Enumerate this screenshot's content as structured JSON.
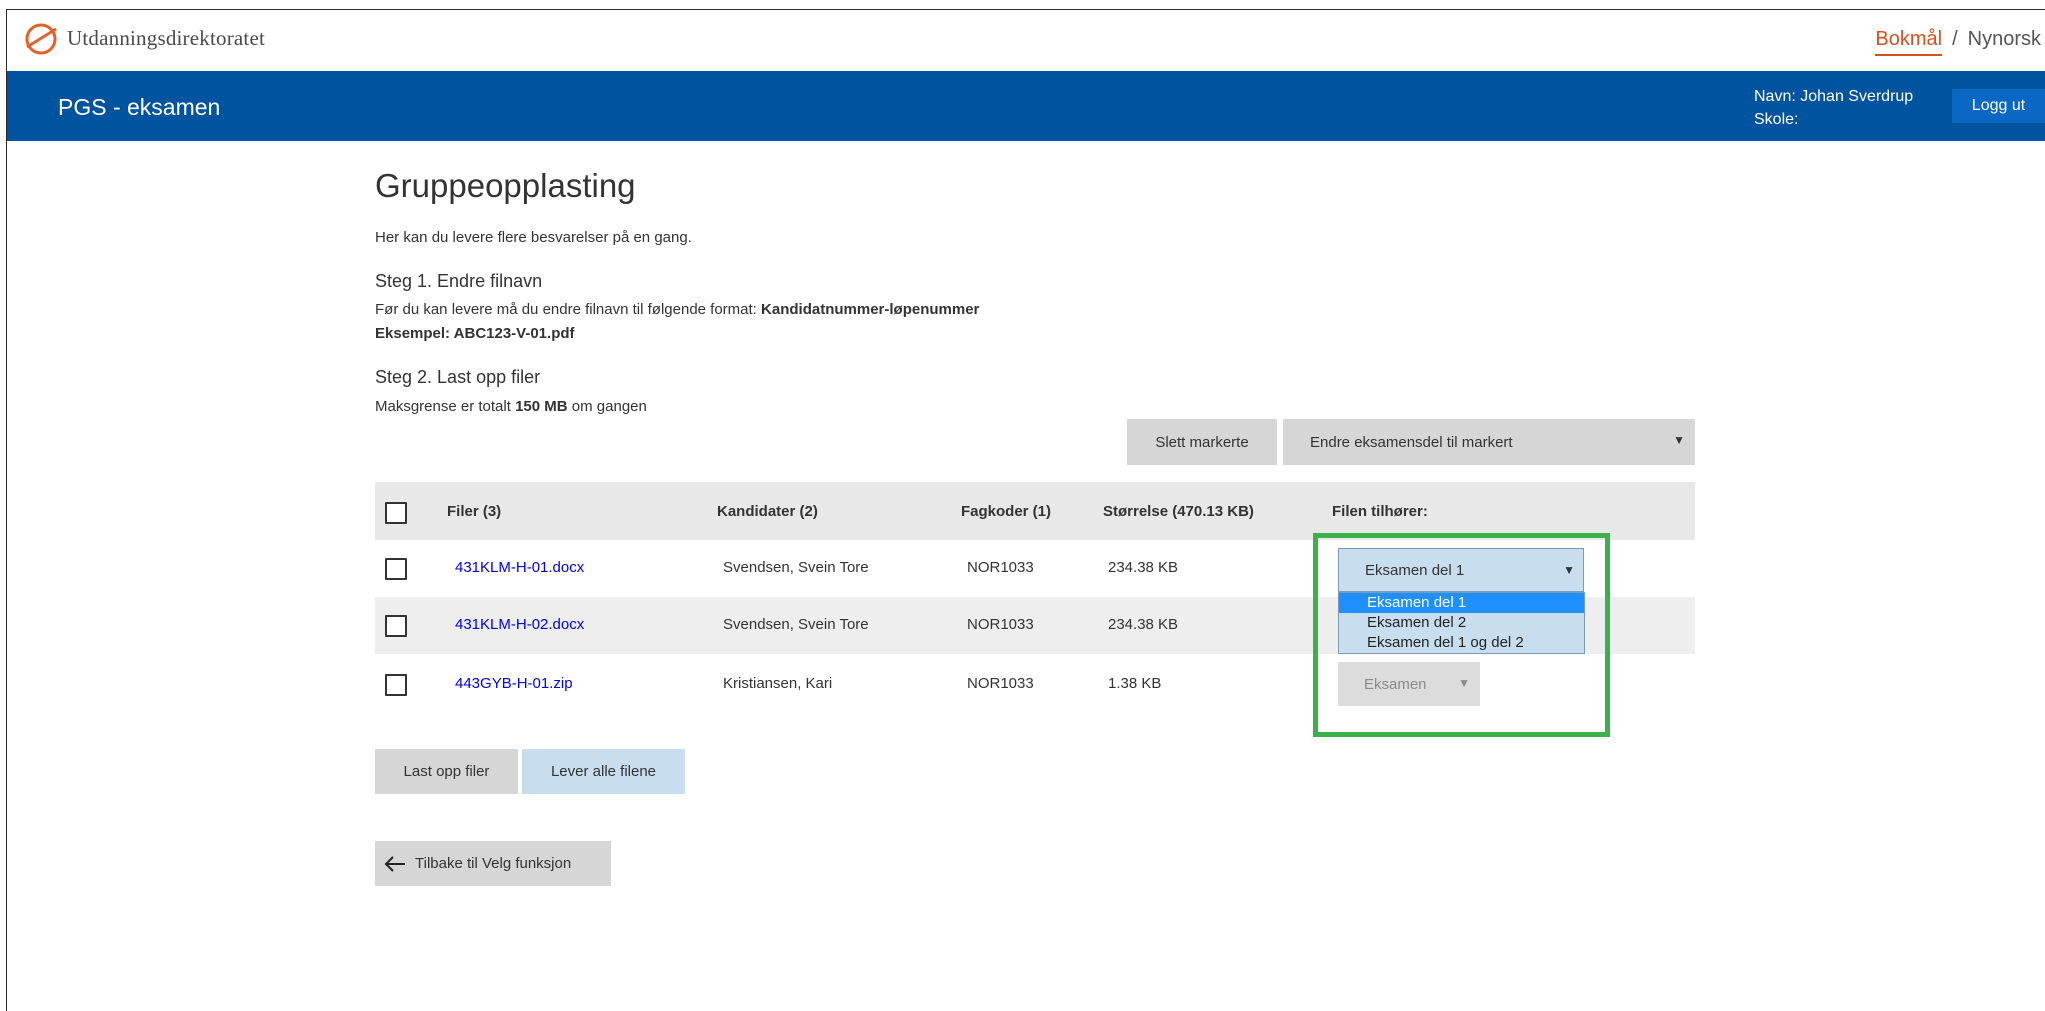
{
  "brand": {
    "logo_text": "Utdanningsdirektoratet",
    "accent_color": "#d4511e",
    "header_color": "#00539f"
  },
  "language": {
    "active": "Bokmål",
    "separator": "/",
    "other": "Nynorsk"
  },
  "header": {
    "app_title": "PGS - eksamen",
    "user_name": "Navn: Johan Sverdrup",
    "school": "Skole:",
    "logout_label": "Logg ut"
  },
  "page": {
    "title": "Gruppeopplasting",
    "intro": "Her kan du levere flere besvarelser på en gang.",
    "step1": {
      "title": "Steg 1. Endre filnavn",
      "line1_prefix": "Før du kan levere må du endre filnavn til følgende format:",
      "line1_bold": "Kandidatnummer-løpenummer",
      "line2": "Eksempel: ABC123-V-01.pdf"
    },
    "step2": {
      "title": "Steg 2. Last opp filer",
      "limit_prefix": "Maksgrense er totalt",
      "limit_bold": "150 MB",
      "limit_suffix": "om gangen"
    }
  },
  "toolbar": {
    "delete_label": "Slett markerte",
    "change_part_label": "Endre eksamensdel til markert"
  },
  "table": {
    "headers": {
      "files": "Filer (3)",
      "candidates": "Kandidater (2)",
      "subject_codes": "Fagkoder (1)",
      "size": "Størrelse (470.13 KB)",
      "belongs_to": "Filen tilhører:"
    },
    "rows": [
      {
        "file": "431KLM-H-01.docx",
        "candidate": "Svendsen, Svein Tore",
        "subject": "NOR1033",
        "size": "234.38 KB",
        "part": "Eksamen del 1"
      },
      {
        "file": "431KLM-H-02.docx",
        "candidate": "Svendsen, Svein Tore",
        "subject": "NOR1033",
        "size": "234.38 KB",
        "part": ""
      },
      {
        "file": "443GYB-H-01.zip",
        "candidate": "Kristiansen, Kari",
        "subject": "NOR1033",
        "size": "1.38 KB",
        "part": "Eksamen"
      }
    ],
    "dropdown_options": [
      "Eksamen del 1",
      "Eksamen del 2",
      "Eksamen del 1 og del 2"
    ]
  },
  "actions": {
    "upload_label": "Last opp filer",
    "deliver_label": "Lever alle filene",
    "back_label": "Tilbake til Velg funksjon"
  },
  "icons": {
    "logo": "udir-logo-icon",
    "dropdown": "triangle-down-icon",
    "back": "arrow-left-icon"
  },
  "highlight_color": "#3cb04a"
}
